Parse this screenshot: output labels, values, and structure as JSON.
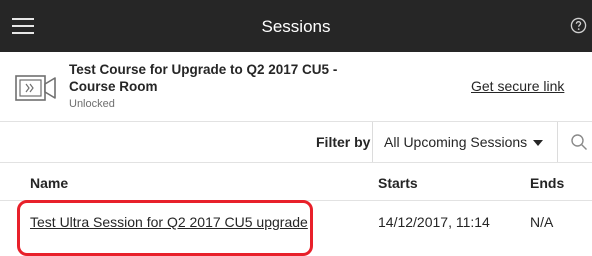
{
  "header": {
    "title": "Sessions",
    "menu_icon": "hamburger-menu-icon",
    "help_icon": "help-circle-icon"
  },
  "course": {
    "icon": "video-camera-icon",
    "title": "Test Course for Upgrade to Q2 2017 CU5 - Course Room",
    "status": "Unlocked",
    "secure_link": "Get secure link"
  },
  "filter": {
    "label": "Filter by",
    "selected": "All Upcoming Sessions",
    "search_icon": "search-icon"
  },
  "table": {
    "columns": [
      "Name",
      "Starts",
      "Ends"
    ],
    "rows": [
      {
        "name": "Test Ultra Session for Q2 2017 CU5 upgrade",
        "starts": "14/12/2017, 11:14",
        "ends": "N/A"
      }
    ]
  },
  "colors": {
    "header_bg": "#262626",
    "highlight": "#e8202a"
  }
}
